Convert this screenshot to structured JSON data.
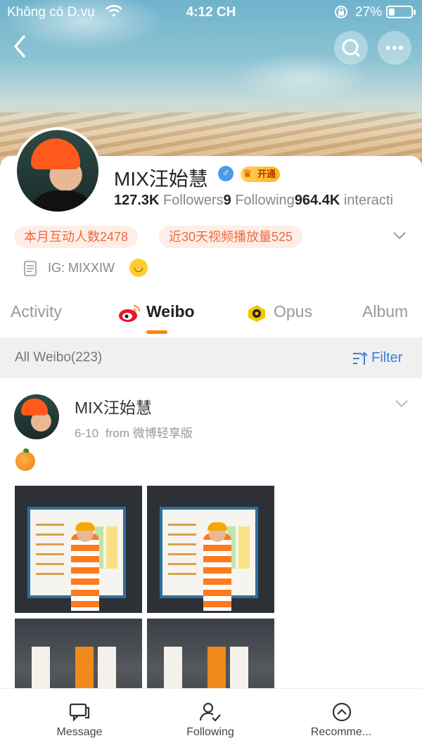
{
  "status_bar": {
    "carrier": "Không có D.vụ",
    "time": "4:12 CH",
    "battery_percent": "27%",
    "battery_level": 0.27
  },
  "top_nav": {
    "back_icon": "chevron-left-icon",
    "search_icon": "search-icon",
    "more_icon": "more-dots-icon"
  },
  "profile": {
    "name": "MIX汪始慧",
    "gender_icon": "male-icon",
    "vip_badge_label": "开通",
    "stats": {
      "followers_value": "127.3K",
      "followers_label": " Followers",
      "following_value": "9",
      "following_label": " Following",
      "interactions_value": "964.4K",
      "interactions_label": " interacti"
    },
    "chips": [
      "本月互动人数2478",
      "近30天视频播放量525"
    ],
    "bio": "IG: MIXXIW"
  },
  "tabs": [
    {
      "label": "Activity",
      "active": false
    },
    {
      "label": "Weibo",
      "active": true
    },
    {
      "label": "Opus",
      "active": false
    },
    {
      "label": "Album",
      "active": false
    }
  ],
  "accent_color": "#ff8200",
  "filter_bar": {
    "count_label": "All Weibo(223)",
    "filter_label": "Filter",
    "filter_color": "#3a7fd6"
  },
  "post": {
    "author": "MIX汪始慧",
    "date": "6-10",
    "source": "from 微博轻享版",
    "content_icon": "orange-emoji-icon",
    "photo_count_visible": 4
  },
  "bottom_bar": {
    "message_label": "Message",
    "following_label": "Following",
    "recommend_label": "Recomme..."
  }
}
